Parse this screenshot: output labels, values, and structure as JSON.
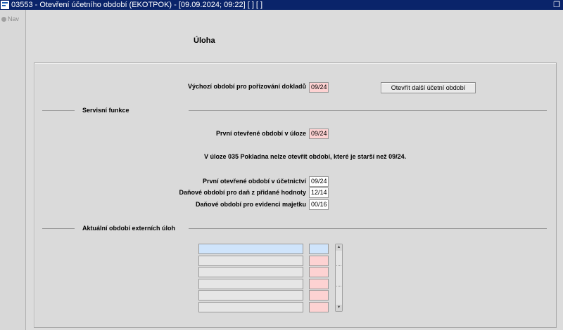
{
  "window": {
    "title": "03553 - Otevření účetního období (EKOTPOK) - [09.09.2024; 09:22]  [ ]  [ ]",
    "restore_icon": "restore-icon"
  },
  "nav": {
    "label": "Nav",
    "icon": "nav-icon"
  },
  "heading": "Úloha",
  "top": {
    "label": "Výchozí období pro pořizování dokladů",
    "value": "09/24",
    "button_label": "Otevřít další účetní období"
  },
  "service": {
    "section_label": "Servisní funkce",
    "first_open_label": "První otevřené období v úloze",
    "first_open_value": "09/24",
    "message": "V úloze 035 Pokladna nelze otevřít období, které je starší než 09/24.",
    "accounting_label": "První otevřené období v účetnictví",
    "accounting_value": "09/24",
    "vat_label": "Daňové období pro daň z přidané hodnoty",
    "vat_value": "12/14",
    "assets_label": "Daňové období pro evidenci majetku",
    "assets_value": "00/16"
  },
  "external": {
    "section_label": "Aktuální období externích úloh",
    "rows": [
      {
        "name": "",
        "period": ""
      },
      {
        "name": "",
        "period": ""
      },
      {
        "name": "",
        "period": ""
      },
      {
        "name": "",
        "period": ""
      },
      {
        "name": "",
        "period": ""
      },
      {
        "name": "",
        "period": ""
      }
    ]
  },
  "colors": {
    "titlebar": "#0a246a",
    "pink_field": "#fdd2d2",
    "blue_field": "#cfe4fb"
  }
}
